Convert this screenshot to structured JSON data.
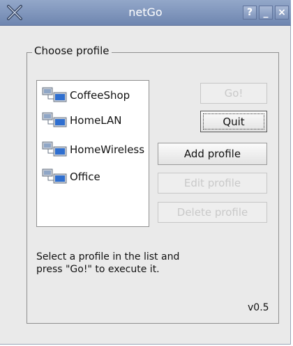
{
  "window": {
    "title": "netGo",
    "help_label": "?",
    "minimize_label": "_",
    "close_label": "×"
  },
  "profiles": {
    "group_label": "Choose profile",
    "items": [
      {
        "label": "CoffeeShop"
      },
      {
        "label": "HomeLAN"
      },
      {
        "label": "HomeWireless"
      },
      {
        "label": "Office"
      }
    ]
  },
  "buttons": {
    "go": "Go!",
    "quit": "Quit",
    "add": "Add profile",
    "edit": "Edit profile",
    "delete": "Delete profile"
  },
  "hint": {
    "line1": "Select a profile in the list and",
    "line2": "press \"Go!\" to execute it."
  },
  "version": "v0.5"
}
